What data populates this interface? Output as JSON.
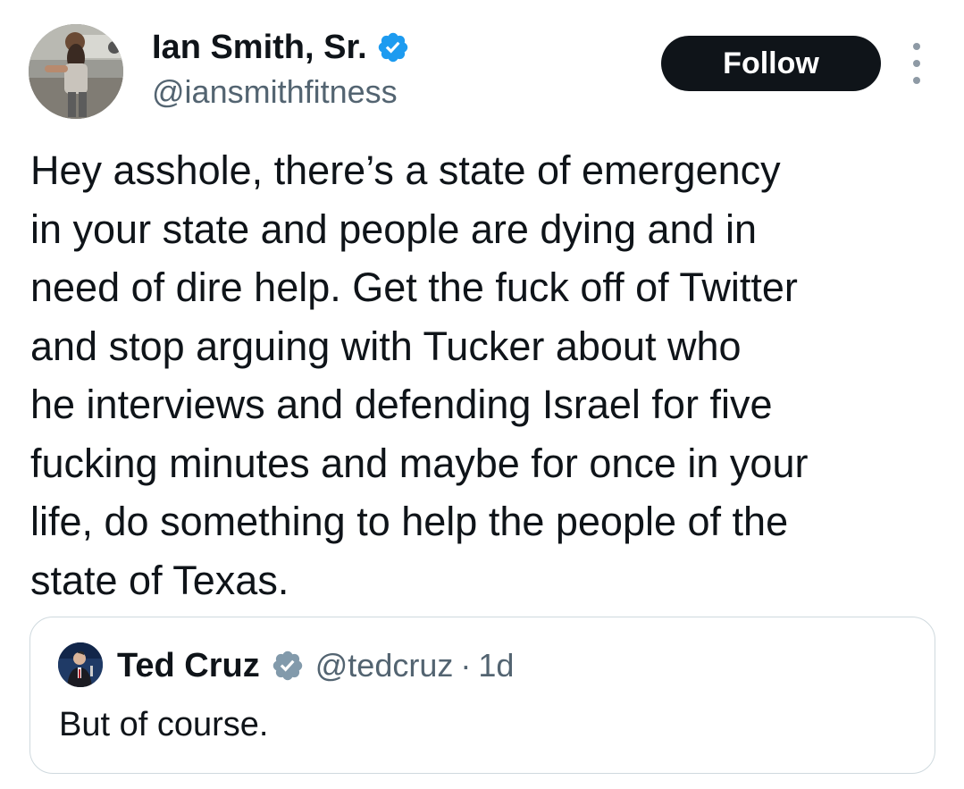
{
  "author": {
    "display_name": "Ian Smith, Sr.",
    "handle": "@iansmithfitness",
    "verified": true,
    "avatar_icon": "avatar-photo"
  },
  "actions": {
    "follow_label": "Follow",
    "more_icon": "more-dots-icon"
  },
  "tweet": {
    "text": "Hey asshole, there’s a state of emergency\nin your state and people are dying and in\nneed of dire help. Get the fuck off of Twitter\nand stop arguing with Tucker about who\nhe interviews and defending Israel for five\nfucking minutes and maybe for once in your\nlife, do something to help the people of the\nstate of Texas."
  },
  "quoted_tweet": {
    "display_name": "Ted Cruz",
    "handle": "@tedcruz",
    "separator": "·",
    "time": "1d",
    "verified": true,
    "text": "But of course.",
    "avatar_icon": "avatar-photo"
  },
  "colors": {
    "follow_bg": "#0f1419",
    "verified_blue": "#1d9bf0",
    "verified_gray": "#829aab",
    "secondary_text": "#536471",
    "border": "#cfd9de"
  }
}
